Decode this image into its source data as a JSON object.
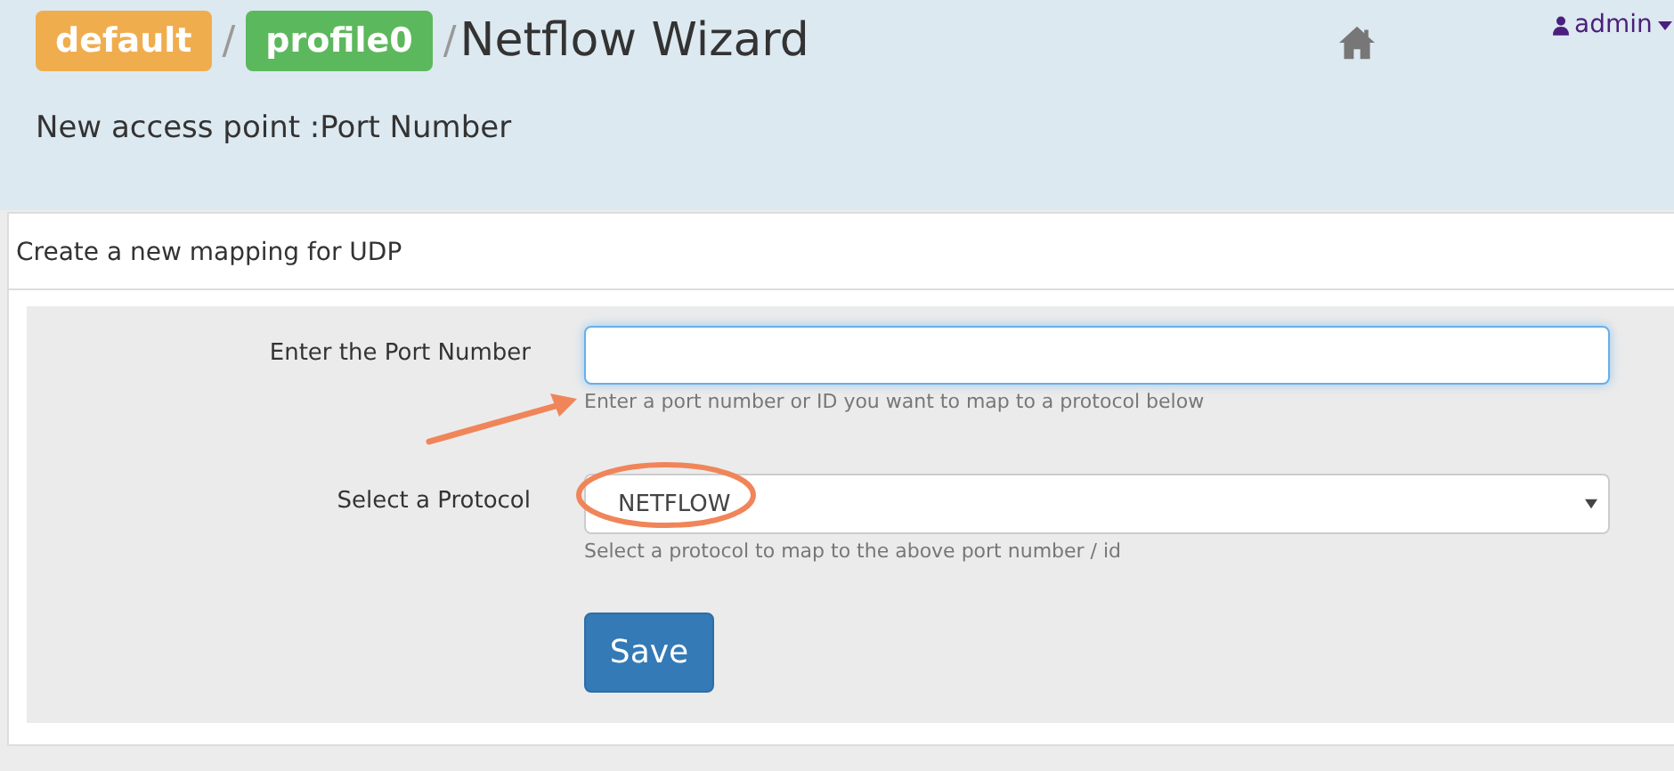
{
  "breadcrumb": [
    {
      "label": "default",
      "color": "#f0ad4e"
    },
    {
      "label": "profile0",
      "color": "#5cb85c"
    }
  ],
  "separator": "/",
  "title": "Netflow Wizard",
  "user": {
    "name": "admin"
  },
  "subtitle": "New access point :Port Number",
  "panel": {
    "heading": "Create a new mapping for UDP",
    "fields": [
      {
        "kind": "input",
        "label": "Enter the Port Number",
        "help": "Enter a port number or ID you want to map to a protocol below"
      },
      {
        "kind": "select",
        "label": "Select a Protocol",
        "value": "NETFLOW",
        "help": "Select a protocol to map to the above port number / id"
      }
    ],
    "button": "Save"
  }
}
